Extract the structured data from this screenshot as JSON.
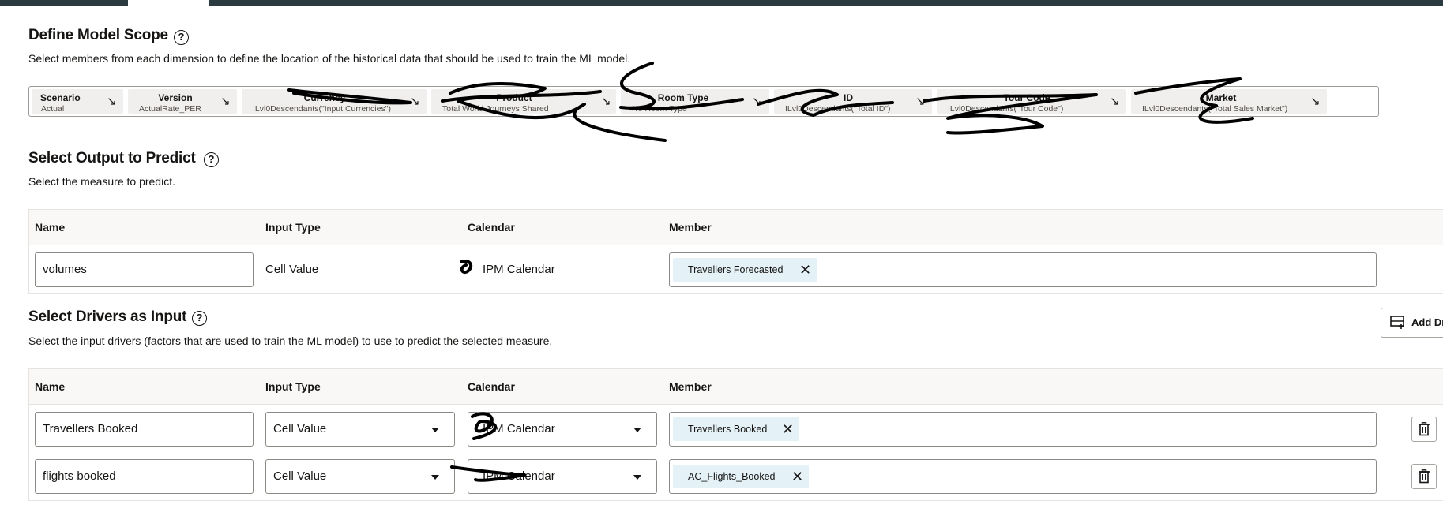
{
  "scope": {
    "title": "Define Model Scope",
    "help": "?",
    "description": "Select members from each dimension to define the location of the historical data that should be used to train the ML model.",
    "pov": [
      {
        "name": "Scenario",
        "value": "Actual"
      },
      {
        "name": "Version",
        "value": "ActualRate_PER"
      },
      {
        "name": "Currency",
        "value": "ILvl0Descendants(\"Input Currencies\")"
      },
      {
        "name": "Product",
        "value": "Total World Journeys Shared"
      },
      {
        "name": "Room Type",
        "value": "No Room Type"
      },
      {
        "name": "ID",
        "value": "ILvl0Descendants(\"Total ID\")"
      },
      {
        "name": "Tour Code",
        "value": "ILvl0Descendants(\"Tour Code\")"
      },
      {
        "name": "Market",
        "value": "ILvl0Descendants(\"Total Sales Market\")"
      }
    ],
    "arrow_glyph": "↘"
  },
  "output": {
    "title": "Select Output to Predict",
    "help": "?",
    "description": "Select the measure to predict.",
    "columns": {
      "name": "Name",
      "input_type": "Input Type",
      "calendar": "Calendar",
      "member": "Member"
    },
    "row": {
      "name": "volumes",
      "input_type": "Cell Value",
      "calendar": "IPM Calendar",
      "member_chip": "Travellers Forecasted"
    }
  },
  "drivers": {
    "title": "Select Drivers as Input",
    "help": "?",
    "description": "Select the input drivers (factors that are used to train the ML model) to use to predict the selected measure.",
    "add_button": "Add Driver",
    "columns": {
      "name": "Name",
      "input_type": "Input Type",
      "calendar": "Calendar",
      "member": "Member"
    },
    "rows": [
      {
        "name": "Travellers Booked",
        "input_type": "Cell Value",
        "calendar": "IPM Calendar",
        "member_chip": "Travellers Booked"
      },
      {
        "name": "flights booked",
        "input_type": "Cell Value",
        "calendar": "IPM Calendar",
        "member_chip": "AC_Flights_Booked"
      }
    ]
  },
  "glyphs": {
    "close": "✕"
  },
  "colors": {
    "header_bar": "#2b3b40",
    "chip": "#e4f1f7",
    "scribble": "#000000"
  },
  "icons": {
    "help": "question-circle-icon",
    "pov_arrow": "arrow-down-right-icon",
    "remove_chip": "close-icon",
    "delete_row": "trash-icon",
    "add_driver": "add-row-icon"
  }
}
